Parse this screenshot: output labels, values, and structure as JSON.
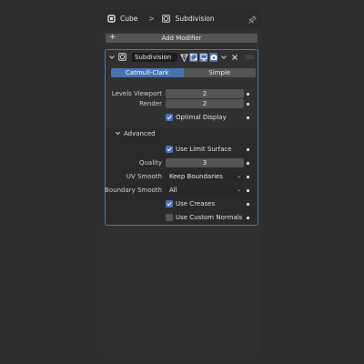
{
  "breadcrumb": {
    "object_name": "Cube",
    "separator": ">",
    "modifier_name": "Subdivision",
    "object_icon": "cube-icon",
    "modifier_icon": "subdivision-modifier-icon",
    "pin_icon": "pin-icon"
  },
  "add_modifier": {
    "label": "Add Modifier",
    "icon": "plus-icon"
  },
  "modifier": {
    "name": "Subdivision",
    "icons": [
      "collapse-chevron-icon",
      "subdivision-modifier-icon",
      "edit-mode-icon",
      "editmode-cage-icon",
      "viewport-display-icon",
      "render-camera-icon",
      "dropdown-chevron-icon",
      "remove-x-icon",
      "drag-handle-icon"
    ],
    "accent": "#3f78c8",
    "tabs": [
      {
        "label": "Catmull-Clark",
        "active": true
      },
      {
        "label": "Simple",
        "active": false
      }
    ],
    "levels_viewport": {
      "label": "Levels Viewport",
      "value": "2"
    },
    "render": {
      "label": "Render",
      "value": "2"
    },
    "optimal_display": {
      "label": "Optimal Display",
      "checked": true
    },
    "advanced": {
      "label": "Advanced",
      "use_limit_surface": {
        "label": "Use Limit Surface",
        "checked": true
      },
      "quality": {
        "label": "Quality",
        "value": "3"
      },
      "uv_smooth": {
        "label": "UV Smooth",
        "value": "Keep Boundaries"
      },
      "boundary_smooth": {
        "label": "Boundary Smooth",
        "value": "All"
      },
      "use_creases": {
        "label": "Use Creases",
        "checked": true
      },
      "use_custom_normals": {
        "label": "Use Custom Normals",
        "checked": false
      }
    }
  }
}
